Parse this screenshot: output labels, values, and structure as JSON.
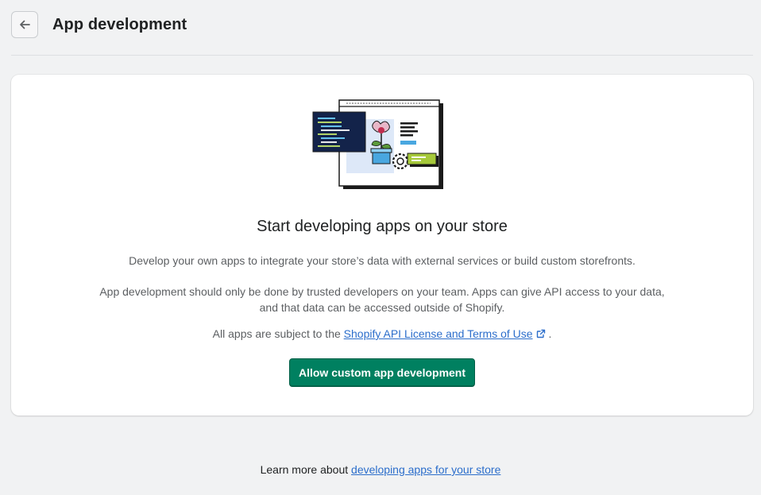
{
  "header": {
    "back_label": "←",
    "title": "App development"
  },
  "card": {
    "heading": "Start developing apps on your store",
    "description": "Develop your own apps to integrate your store’s data with external services or build custom storefronts.",
    "warning_line1": "App development should only be done by trusted developers on your team. Apps can give API access to your data,",
    "warning_line2": "and that data can be accessed outside of Shopify.",
    "terms_prefix": "All apps are subject to the",
    "terms_link": "Shopify API License and Terms of Use",
    "terms_suffix": ".",
    "primary_button": "Allow custom app development"
  },
  "footer": {
    "prefix": "Learn more about",
    "link": "developing apps for your store"
  },
  "colors": {
    "primary": "#008060",
    "link": "#2c6ecb",
    "background": "#f1f2f3"
  }
}
